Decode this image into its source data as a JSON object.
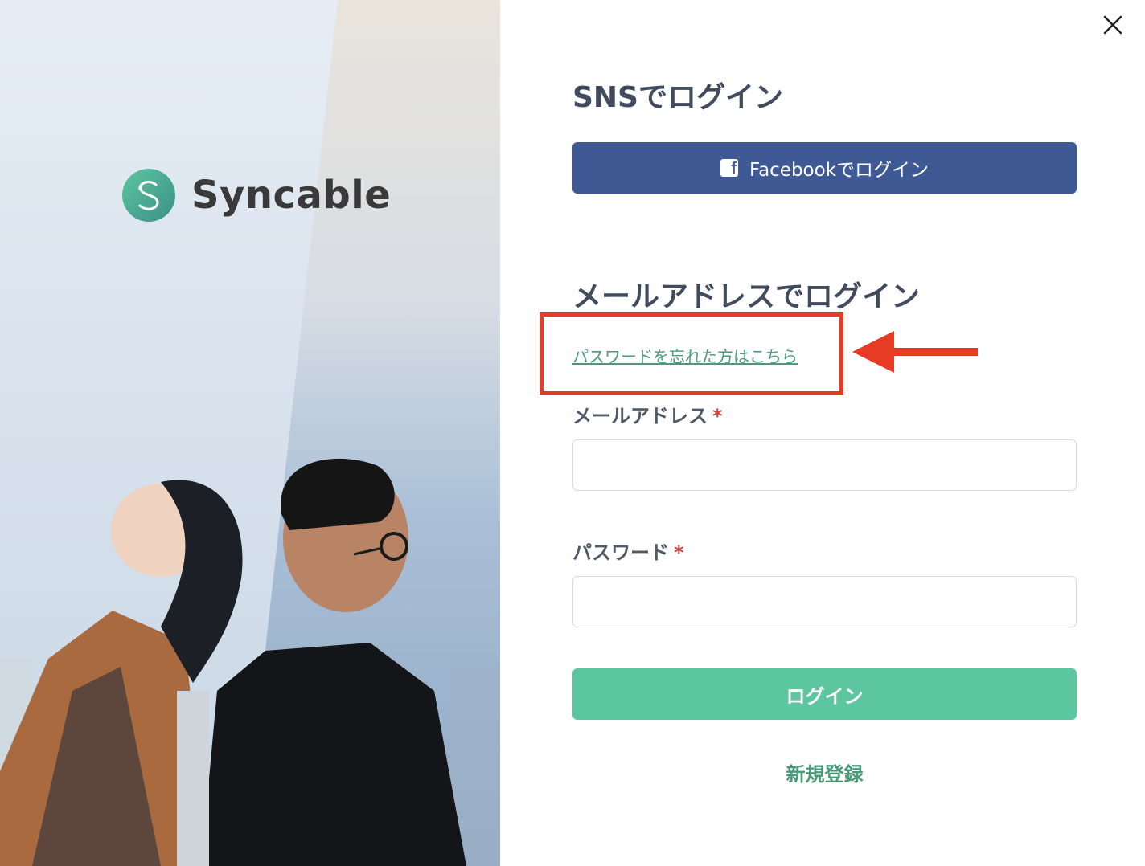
{
  "brand": {
    "name": "Syncable",
    "colors": {
      "accent": "#5cc6a0",
      "link": "#4a9a7a",
      "facebook": "#3f5994",
      "highlight": "#e63b24"
    }
  },
  "sns": {
    "title": "SNSでログイン",
    "facebook_button": {
      "label": "Facebookでログイン",
      "icon": "facebook-icon"
    }
  },
  "email_login": {
    "title": "メールアドレスでログイン",
    "forgot_password_link": "パスワードを忘れた方はこちら",
    "email": {
      "label": "メールアドレス",
      "required_mark": "*",
      "value": "",
      "placeholder": ""
    },
    "password": {
      "label": "パスワード",
      "required_mark": "*",
      "value": "",
      "placeholder": ""
    },
    "submit_label": "ログイン",
    "register_link": "新規登録"
  },
  "icons": {
    "close": "close-icon",
    "arrow": "arrow-left-icon",
    "logo": "syncable-logo-icon"
  }
}
